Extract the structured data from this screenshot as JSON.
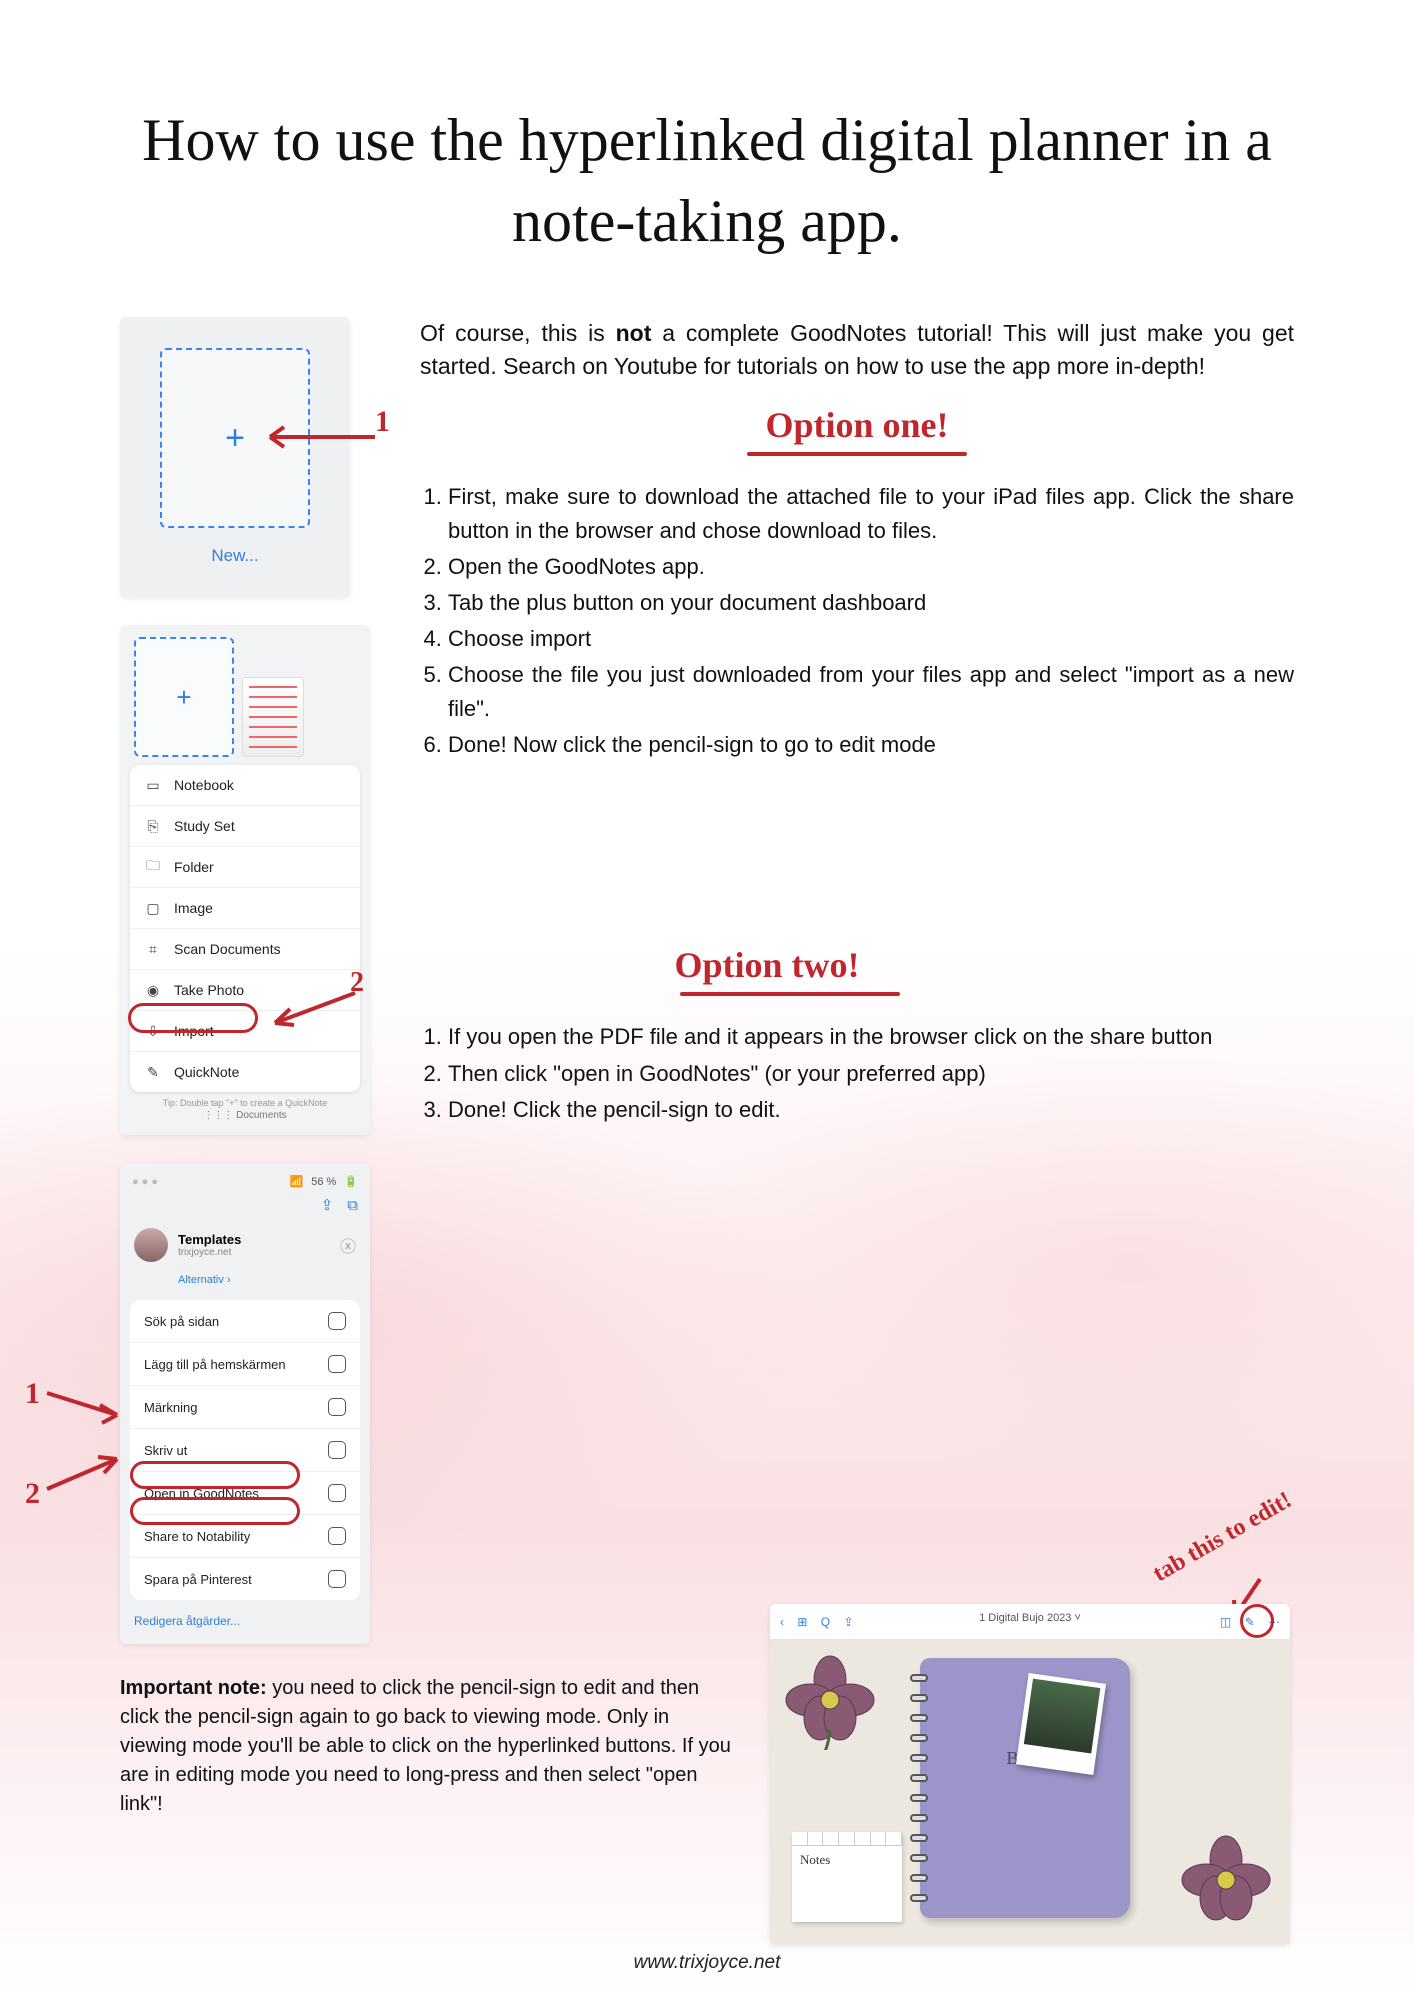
{
  "title": "How to use the hyperlinked digital planner in a note-taking app.",
  "intro_pre": "Of course, this is ",
  "intro_bold": "not",
  "intro_post": " a complete GoodNotes tutorial! This will just make you get started. Search on Youtube for tutorials on how to use the app more in-depth!",
  "option_one_label": "Option one!",
  "option_two_label": "Option two!",
  "steps_one": [
    "First, make sure to download the attached file to your iPad files app. Click the share button in the browser and chose download to files.",
    "Open the GoodNotes app.",
    "Tab the plus button on your document dashboard",
    "Choose import",
    "Choose the file you just downloaded from your files app and select \"import as a new file\".",
    "Done! Now click the pencil-sign to go to edit mode"
  ],
  "steps_two": [
    "If you open the PDF file and it appears in the browser click on the share button",
    " Then click \"open in GoodNotes\" (or your preferred app)",
    "Done! Click the pencil-sign to edit."
  ],
  "screenshot_new_label": "New...",
  "menu_items": [
    {
      "icon": "notebook-icon",
      "label": "Notebook"
    },
    {
      "icon": "studyset-icon",
      "label": "Study Set"
    },
    {
      "icon": "folder-icon",
      "label": "Folder"
    },
    {
      "icon": "image-icon",
      "label": "Image"
    },
    {
      "icon": "scan-icon",
      "label": "Scan Documents"
    },
    {
      "icon": "camera-icon",
      "label": "Take Photo"
    },
    {
      "icon": "import-icon",
      "label": "Import"
    },
    {
      "icon": "quicknote-icon",
      "label": "QuickNote"
    }
  ],
  "menu_tip": "Tip: Double tap \"+\" to create a QuickNote",
  "menu_docs_label": "⋮⋮⋮ Documents",
  "share_status": "56 %",
  "share_title": "Templates",
  "share_sub": "trixjoyce.net",
  "share_alt": "Alternativ ›",
  "share_items": [
    "Sök på sidan",
    "Lägg till på hemskärmen",
    "Märkning",
    "Skriv ut",
    "Open in GoodNotes",
    "Share to Notability",
    "Spara på Pinterest"
  ],
  "share_edit": "Redigera åtgärder...",
  "annotation_1": "1",
  "annotation_2": "2",
  "annotation_tab_edit": "tab this to edit!",
  "planner_title": "1 Digital Bujo 2023 ˅",
  "planner_notebook_label": "BuJo",
  "planner_sticky_label": "Notes",
  "important_label": "Important note:",
  "important_text": " you need to click the pencil-sign to edit and then click the pencil-sign again to go back to viewing mode. Only in viewing mode you'll be able to click on the hyperlinked buttons. If you are in editing mode you need to long-press and then select \"open link\"!",
  "footer": "www.trixjoyce.net"
}
